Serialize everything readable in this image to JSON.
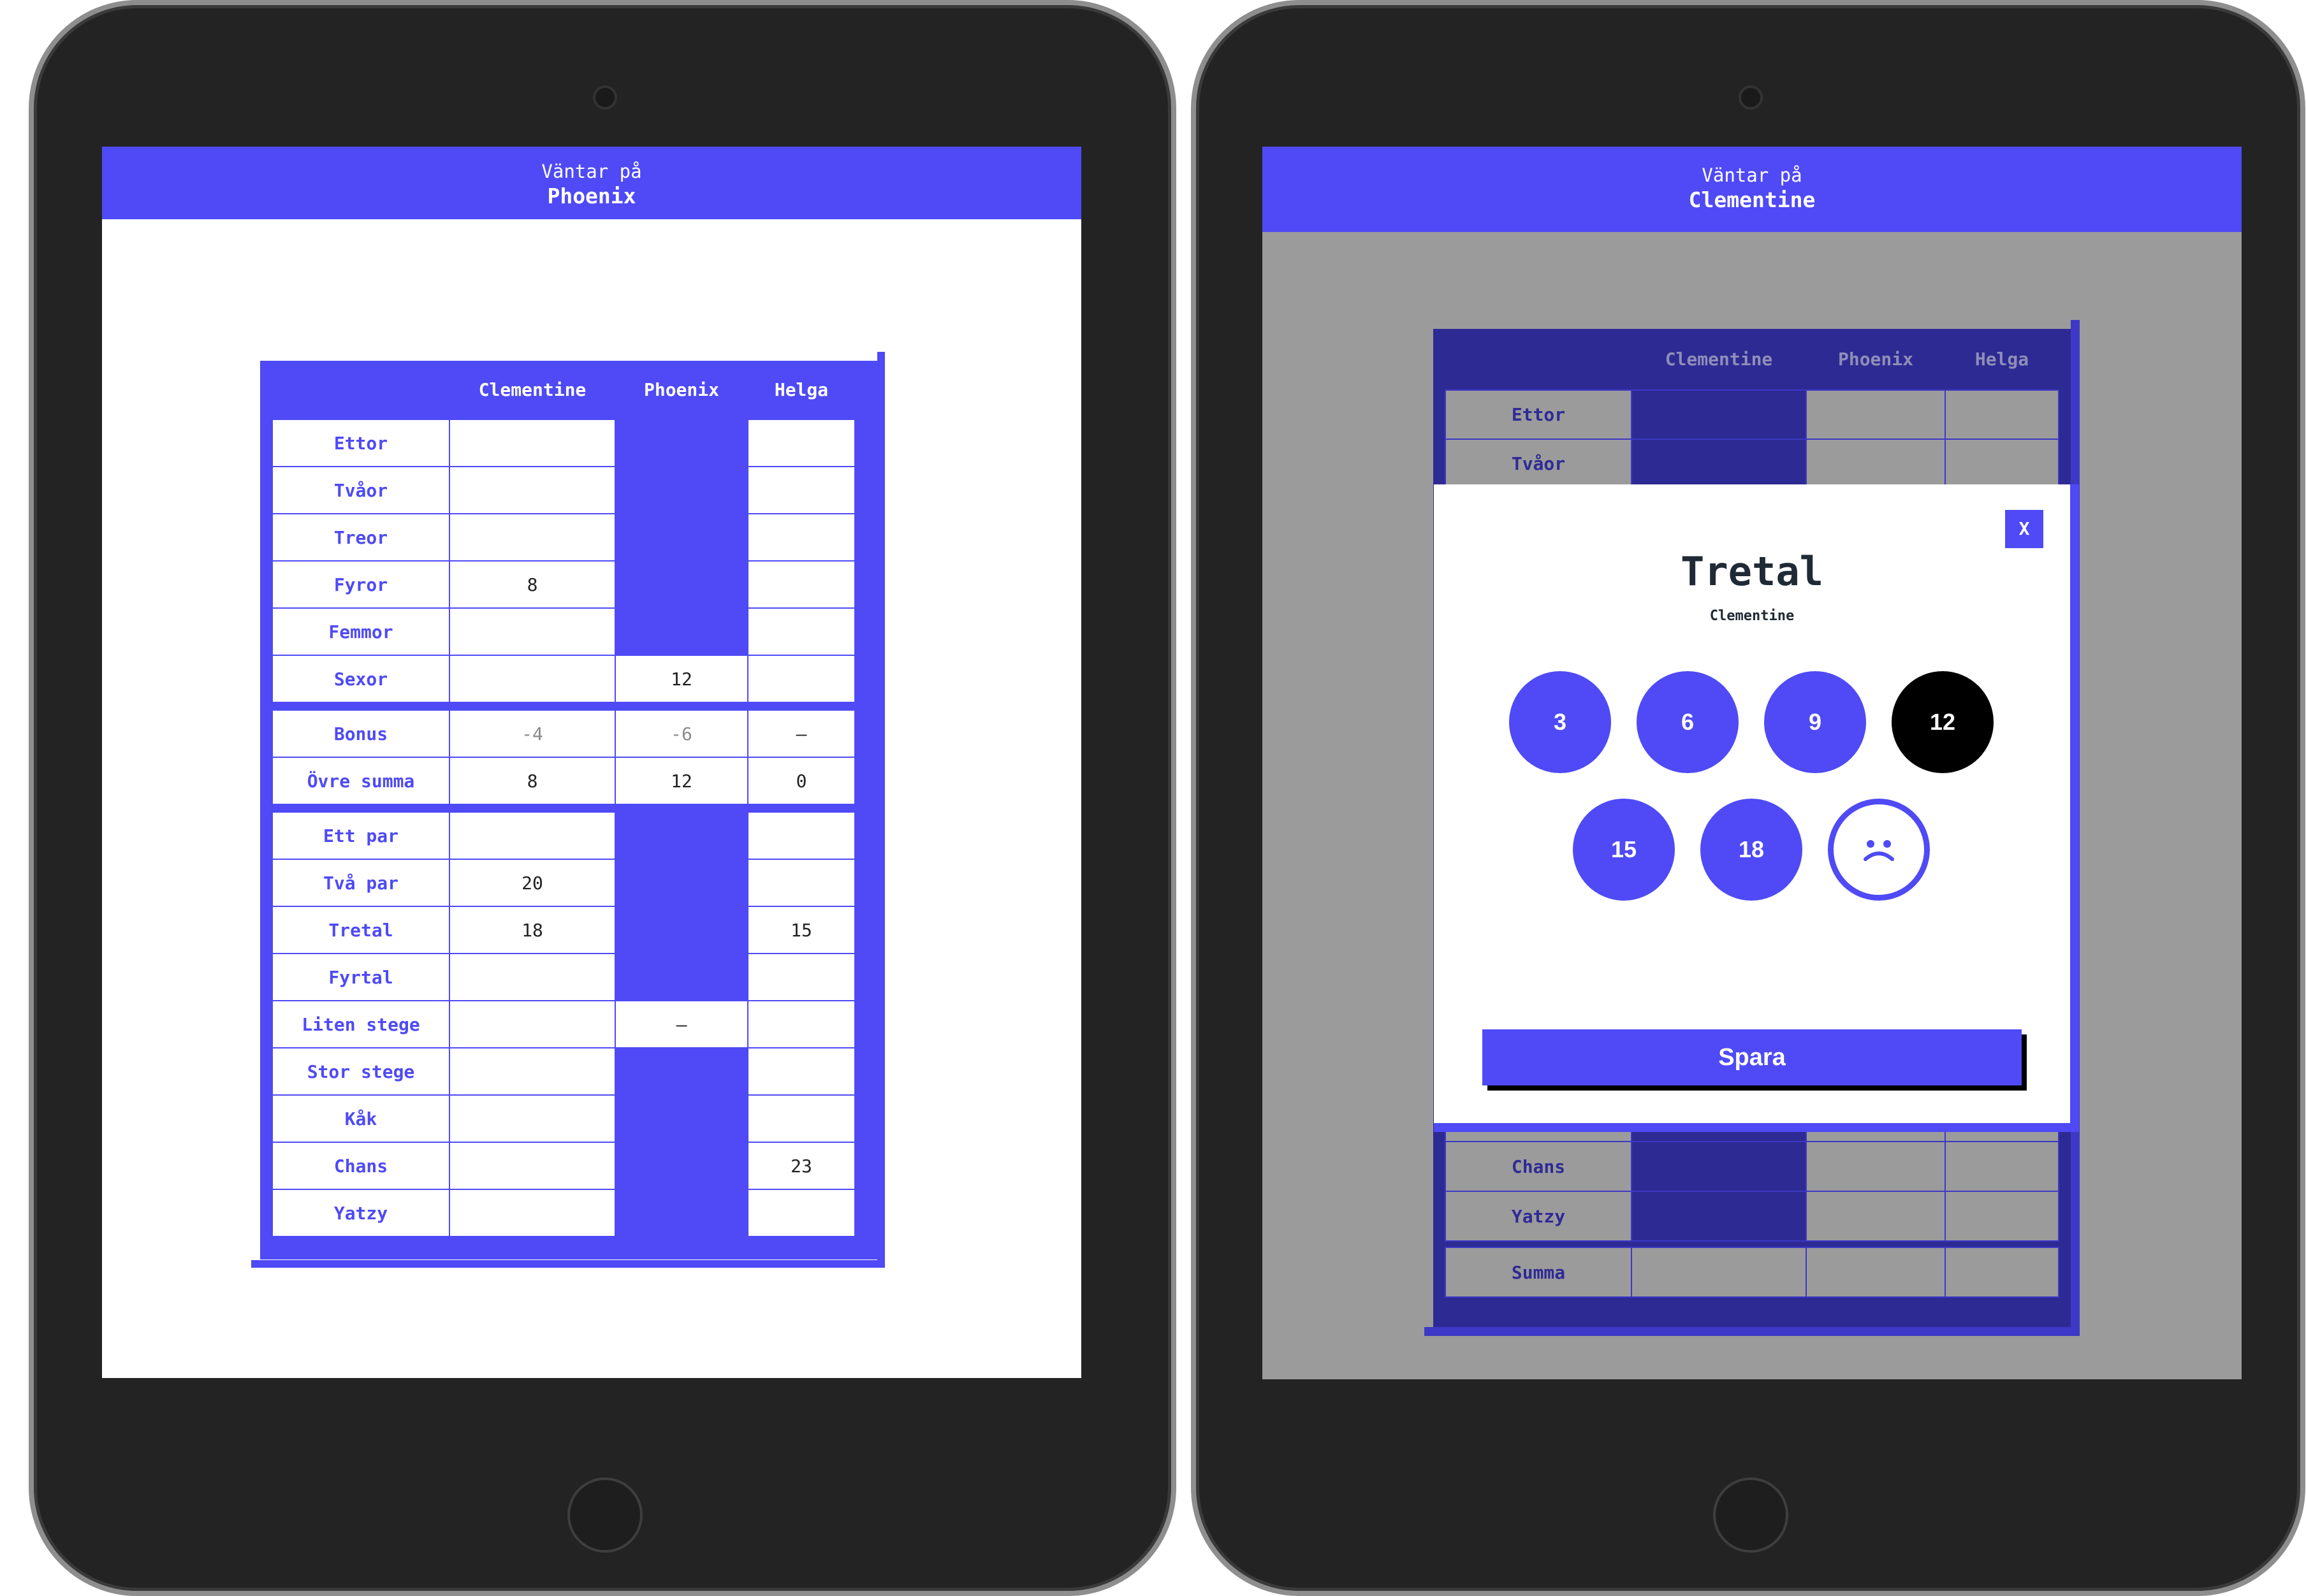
{
  "colors": {
    "accent": "#4f4af5",
    "dim_accent": "#2e2a93",
    "overlay": "#9b9b9b",
    "selected": "#000000"
  },
  "left_tablet": {
    "header": {
      "waiting_label": "Väntar på",
      "player": "Phoenix"
    },
    "table": {
      "columns": [
        "Clementine",
        "Phoenix",
        "Helga"
      ],
      "upper_rows": [
        {
          "label": "Ettor",
          "cells": [
            "",
            "",
            ""
          ],
          "filled": [
            false,
            true,
            false
          ]
        },
        {
          "label": "Tvåor",
          "cells": [
            "",
            "",
            ""
          ],
          "filled": [
            false,
            true,
            false
          ]
        },
        {
          "label": "Treor",
          "cells": [
            "",
            "",
            ""
          ],
          "filled": [
            false,
            true,
            false
          ]
        },
        {
          "label": "Fyror",
          "cells": [
            "8",
            "",
            ""
          ],
          "filled": [
            false,
            true,
            false
          ]
        },
        {
          "label": "Femmor",
          "cells": [
            "",
            "",
            ""
          ],
          "filled": [
            false,
            true,
            false
          ]
        },
        {
          "label": "Sexor",
          "cells": [
            "",
            "12",
            ""
          ],
          "filled": [
            false,
            false,
            false
          ]
        }
      ],
      "bonus_rows": [
        {
          "label": "Bonus",
          "cells": [
            "-4",
            "-6",
            "–"
          ]
        },
        {
          "label": "Övre summa",
          "cells": [
            "8",
            "12",
            "0"
          ]
        }
      ],
      "lower_rows": [
        {
          "label": "Ett par",
          "cells": [
            "",
            "",
            ""
          ],
          "filled": [
            false,
            true,
            false
          ]
        },
        {
          "label": "Två par",
          "cells": [
            "20",
            "",
            ""
          ],
          "filled": [
            false,
            true,
            false
          ]
        },
        {
          "label": "Tretal",
          "cells": [
            "18",
            "",
            "15"
          ],
          "filled": [
            false,
            true,
            false
          ]
        },
        {
          "label": "Fyrtal",
          "cells": [
            "",
            "",
            ""
          ],
          "filled": [
            false,
            true,
            false
          ]
        },
        {
          "label": "Liten stege",
          "cells": [
            "",
            "–",
            ""
          ],
          "filled": [
            false,
            false,
            false
          ]
        },
        {
          "label": "Stor stege",
          "cells": [
            "",
            "",
            ""
          ],
          "filled": [
            false,
            true,
            false
          ]
        },
        {
          "label": "Kåk",
          "cells": [
            "",
            "",
            ""
          ],
          "filled": [
            false,
            true,
            false
          ]
        },
        {
          "label": "Chans",
          "cells": [
            "",
            "",
            "23"
          ],
          "filled": [
            false,
            true,
            false
          ]
        },
        {
          "label": "Yatzy",
          "cells": [
            "",
            "",
            ""
          ],
          "filled": [
            false,
            true,
            false
          ]
        }
      ]
    }
  },
  "right_tablet": {
    "header": {
      "waiting_label": "Väntar på",
      "player": "Clementine"
    },
    "table": {
      "columns": [
        "Clementine",
        "Phoenix",
        "Helga"
      ],
      "visible_top_rows": [
        "Ettor",
        "Tvåor"
      ],
      "visible_bottom_rows": [
        "Chans",
        "Yatzy"
      ],
      "sum_label": "Summa"
    },
    "modal": {
      "close_label": "X",
      "title": "Tretal",
      "player": "Clementine",
      "options": [
        "3",
        "6",
        "9",
        "12",
        "15",
        "18"
      ],
      "selected": "12",
      "no_score_icon": "sad-face-icon",
      "save_label": "Spara"
    }
  }
}
